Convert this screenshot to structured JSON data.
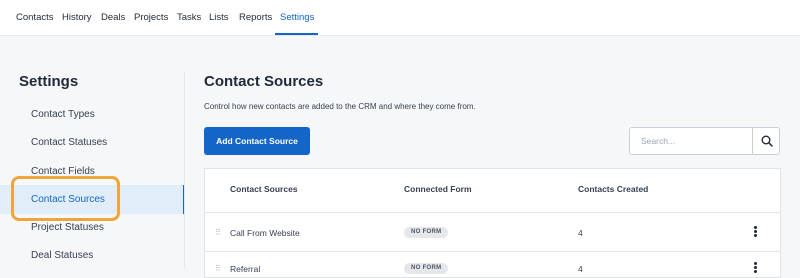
{
  "topnav": {
    "items": [
      {
        "label": "Contacts"
      },
      {
        "label": "History"
      },
      {
        "label": "Deals"
      },
      {
        "label": "Projects"
      },
      {
        "label": "Tasks"
      },
      {
        "label": "Lists"
      },
      {
        "label": "Reports"
      },
      {
        "label": "Settings",
        "active": true
      }
    ],
    "accent_color": "#1366c8"
  },
  "sidebar": {
    "title": "Settings",
    "items": [
      {
        "label": "Contact Types"
      },
      {
        "label": "Contact Statuses"
      },
      {
        "label": "Contact Fields"
      },
      {
        "label": "Contact Sources",
        "active": true
      },
      {
        "label": "Project Statuses"
      },
      {
        "label": "Deal Statuses"
      }
    ],
    "highlight_color": "#f0a43a"
  },
  "main": {
    "title": "Contact Sources",
    "description": "Control how new contacts are added to the CRM and where they come from.",
    "add_button_label": "Add Contact Source",
    "search": {
      "placeholder": "Search...",
      "value": "",
      "icon": "search-icon"
    },
    "table": {
      "columns": [
        "Contact Sources",
        "Connected Form",
        "Contacts Created"
      ],
      "rows": [
        {
          "name": "Call From Website",
          "form": "NO FORM",
          "count": "4"
        },
        {
          "name": "Referral",
          "form": "NO FORM",
          "count": "4"
        }
      ]
    }
  }
}
